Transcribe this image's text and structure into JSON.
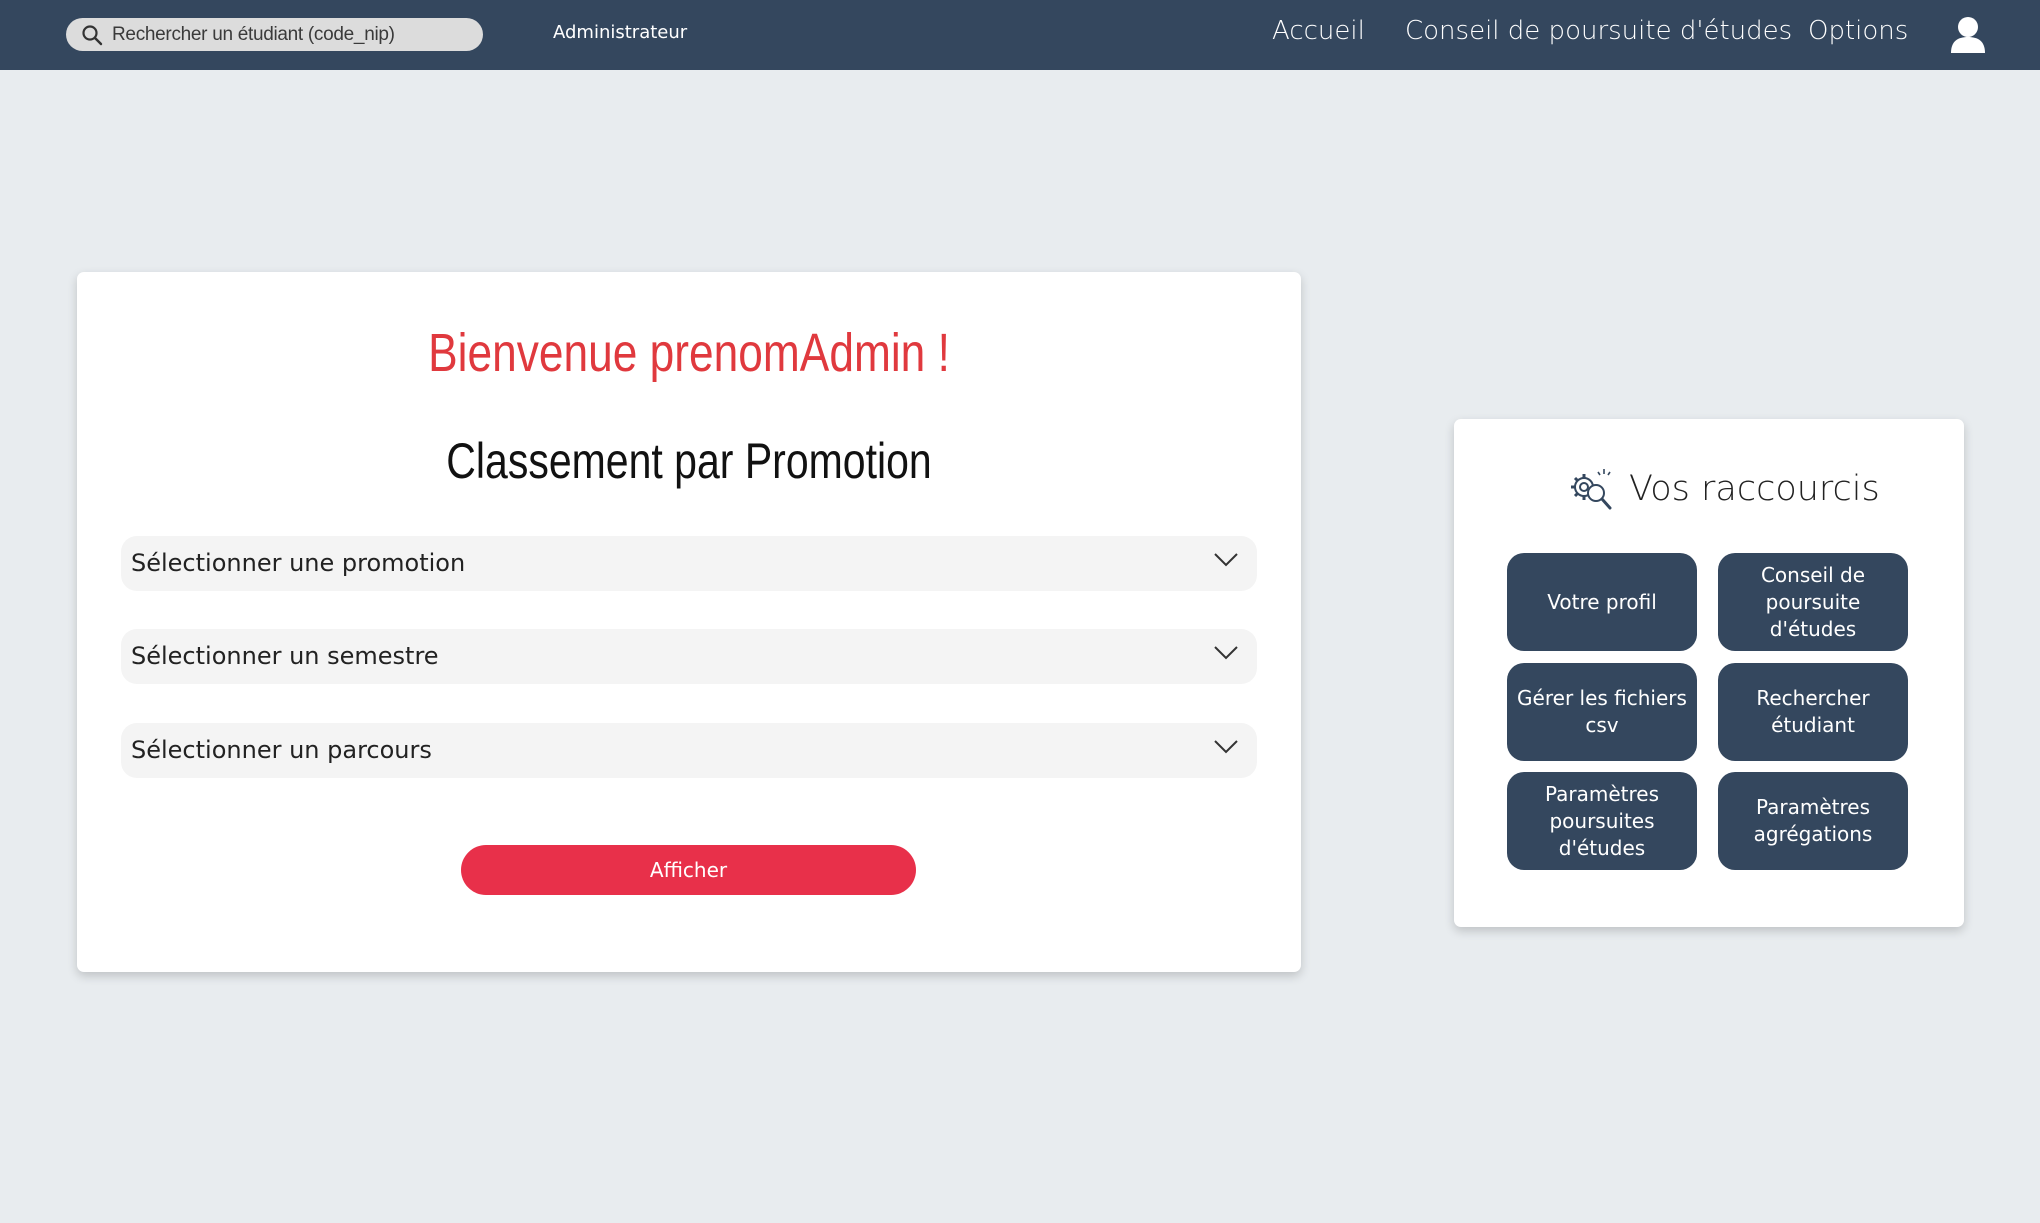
{
  "navbar": {
    "search_placeholder": "Rechercher un étudiant (code_nip)",
    "role": "Administrateur",
    "links": [
      "Accueil",
      "Conseil de poursuite d'études",
      "Options"
    ]
  },
  "main": {
    "welcome": "Bienvenue prenomAdmin !",
    "title": "Classement par Promotion",
    "selects": [
      "Sélectionner une promotion",
      "Sélectionner un semestre",
      "Sélectionner un parcours"
    ],
    "button": "Afficher"
  },
  "shortcuts": {
    "title": "Vos raccourcis",
    "items": [
      "Votre profil",
      "Conseil de poursuite d'études",
      "Gérer les fichiers csv",
      "Rechercher étudiant",
      "Paramètres poursuites d'études",
      "Paramètres agrégations"
    ]
  },
  "colors": {
    "navbar": "#34475e",
    "accent_red": "#e0393e",
    "button_red": "#e8304a",
    "background": "#e8ecef"
  }
}
